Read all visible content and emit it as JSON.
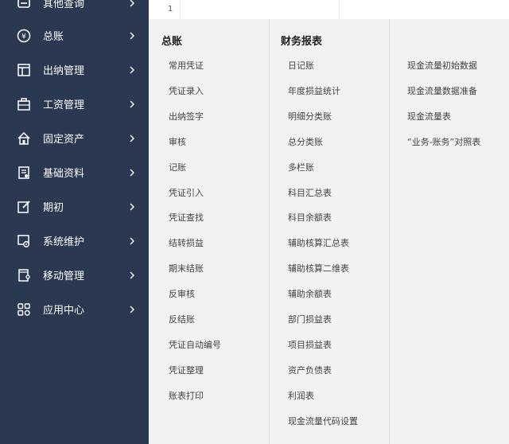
{
  "grid": {
    "row_number": "1"
  },
  "sidebar": {
    "items": [
      {
        "label": "其他查询",
        "icon": "query-icon"
      },
      {
        "label": "总账",
        "icon": "yen-icon"
      },
      {
        "label": "出纳管理",
        "icon": "layout-icon"
      },
      {
        "label": "工资管理",
        "icon": "briefcase-icon"
      },
      {
        "label": "固定资产",
        "icon": "home-icon"
      },
      {
        "label": "基础资料",
        "icon": "document-icon"
      },
      {
        "label": "期初",
        "icon": "edit-icon"
      },
      {
        "label": "系统维护",
        "icon": "settings-icon"
      },
      {
        "label": "移动管理",
        "icon": "mobile-icon"
      },
      {
        "label": "应用中心",
        "icon": "apps-icon"
      }
    ]
  },
  "flyout": {
    "col1": {
      "title": "总账",
      "items": [
        "常用凭证",
        "凭证录入",
        "出纳签字",
        "审核",
        "记账",
        "凭证引入",
        "凭证查找",
        "结转损益",
        "期末结账",
        "反审核",
        "反结账",
        "凭证自动编号",
        "凭证整理",
        "账表打印"
      ]
    },
    "col2": {
      "title": "财务报表",
      "items": [
        "日记账",
        "年度损益统计",
        "明细分类账",
        "总分类账",
        "多栏账",
        "科目汇总表",
        "科目余额表",
        "辅助核算汇总表",
        "辅助核算二维表",
        "辅助余额表",
        "部门损益表",
        "项目损益表",
        "资产负债表",
        "利润表",
        "现金流量代码设置"
      ]
    },
    "col3": {
      "items": [
        "现金流量初始数据",
        "现金流量数据准备",
        "现金流量表",
        "“业务-账务”对照表"
      ]
    }
  },
  "colors": {
    "sidebar_bg": "#2b3852",
    "flyout_bg": "#f2f2f2",
    "text_white": "#ffffff"
  }
}
